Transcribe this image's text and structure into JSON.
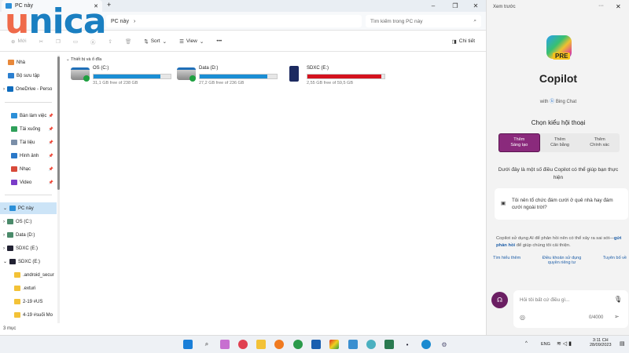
{
  "window": {
    "tab_title": "PC này",
    "new_tab": "+",
    "minimize": "–",
    "restore": "❐",
    "close": "✕"
  },
  "address": {
    "path": "PC này",
    "separator": "›",
    "search_placeholder": "Tìm kiếm trong PC này"
  },
  "toolbar": {
    "new": "Mới",
    "sort": "Sort",
    "view": "View",
    "more": "•••",
    "details": "Chi tiết"
  },
  "sidebar": {
    "items": [
      {
        "label": "Nhà",
        "color": "#e8883a"
      },
      {
        "label": "Bộ sưu tập",
        "color": "#2b7fd0"
      },
      {
        "label": "OneDrive - Perso",
        "color": "#0f6cbd"
      },
      {
        "label": "Bàn làm việc",
        "color": "#2b8fd8"
      },
      {
        "label": "Tải xuống",
        "color": "#2fa05a"
      },
      {
        "label": "Tài liệu",
        "color": "#7a8ea8"
      },
      {
        "label": "Hình ảnh",
        "color": "#2a78c8"
      },
      {
        "label": "Nhạc",
        "color": "#d84a3a"
      },
      {
        "label": "Video",
        "color": "#7a3cc8"
      },
      {
        "label": "PC này",
        "color": "#2b8fd8"
      },
      {
        "label": "OS (C:)",
        "color": "#4a8a6a"
      },
      {
        "label": "Data (D:)",
        "color": "#4a8a6a"
      },
      {
        "label": "SDXC (E:)",
        "color": "#223"
      },
      {
        "label": "SDXC (E:)",
        "color": "#223"
      },
      {
        "label": ".android_secur",
        "color": "#f3c237"
      },
      {
        "label": ".exturi",
        "color": "#f3c237"
      },
      {
        "label": "2-19 #US",
        "color": "#f3c237"
      },
      {
        "label": "4-19 #suối Mo",
        "color": "#f3c237"
      }
    ]
  },
  "content": {
    "group": "Thiết bị và ổ đĩa",
    "drives": [
      {
        "name": "OS (C:)",
        "free": "31,1 GB free of 238 GB",
        "used_fraction": 0.87,
        "color": "#1a8ed4"
      },
      {
        "name": "Data (D:)",
        "free": "27,2 GB free of 236 GB",
        "used_fraction": 0.88,
        "color": "#1a8ed4"
      },
      {
        "name": "SDXC (E:)",
        "free": "2,55 GB free of 59,5 GB",
        "used_fraction": 0.96,
        "color": "#d4121e"
      }
    ]
  },
  "status": "3 mục",
  "copilot": {
    "header": "Xem trước",
    "more": "···",
    "close": "✕",
    "badge": "PRE",
    "title": "Copilot",
    "with": "with",
    "bing": "Bing Chat",
    "mode_label": "Chọn kiểu hội thoại",
    "modes": [
      {
        "top": "Thêm",
        "bottom": "Sáng tạo"
      },
      {
        "top": "Thêm",
        "bottom": "Cân bằng"
      },
      {
        "top": "Thêm",
        "bottom": "Chính xác"
      }
    ],
    "intro": "Dưới đây là một số điều Copilot có thể giúp bạn thực hiện",
    "suggestion": "Tôi nên tổ chức đám cưới ở quê nhà hay đám cưới ngoài trời?",
    "disclaimer_a": "Copilot sử dụng AI để phản hồi nên có thể xảy ra sai sót—",
    "disclaimer_link": "gửi phản hồi",
    "disclaimer_b": " để giúp chúng tôi cải thiện.",
    "links": [
      "Tìm hiểu thêm",
      "Điều khoản sử dụng quyền riêng tư",
      "Tuyên bố về"
    ],
    "input_placeholder": "Hỏi tôi bất cứ điều gì...",
    "counter": "0/4000"
  },
  "taskbar": {
    "lang": "ENG",
    "time": "3:11 CH",
    "date": "28/09/2023"
  },
  "logo": {
    "u": "u",
    "rest": "nica"
  }
}
